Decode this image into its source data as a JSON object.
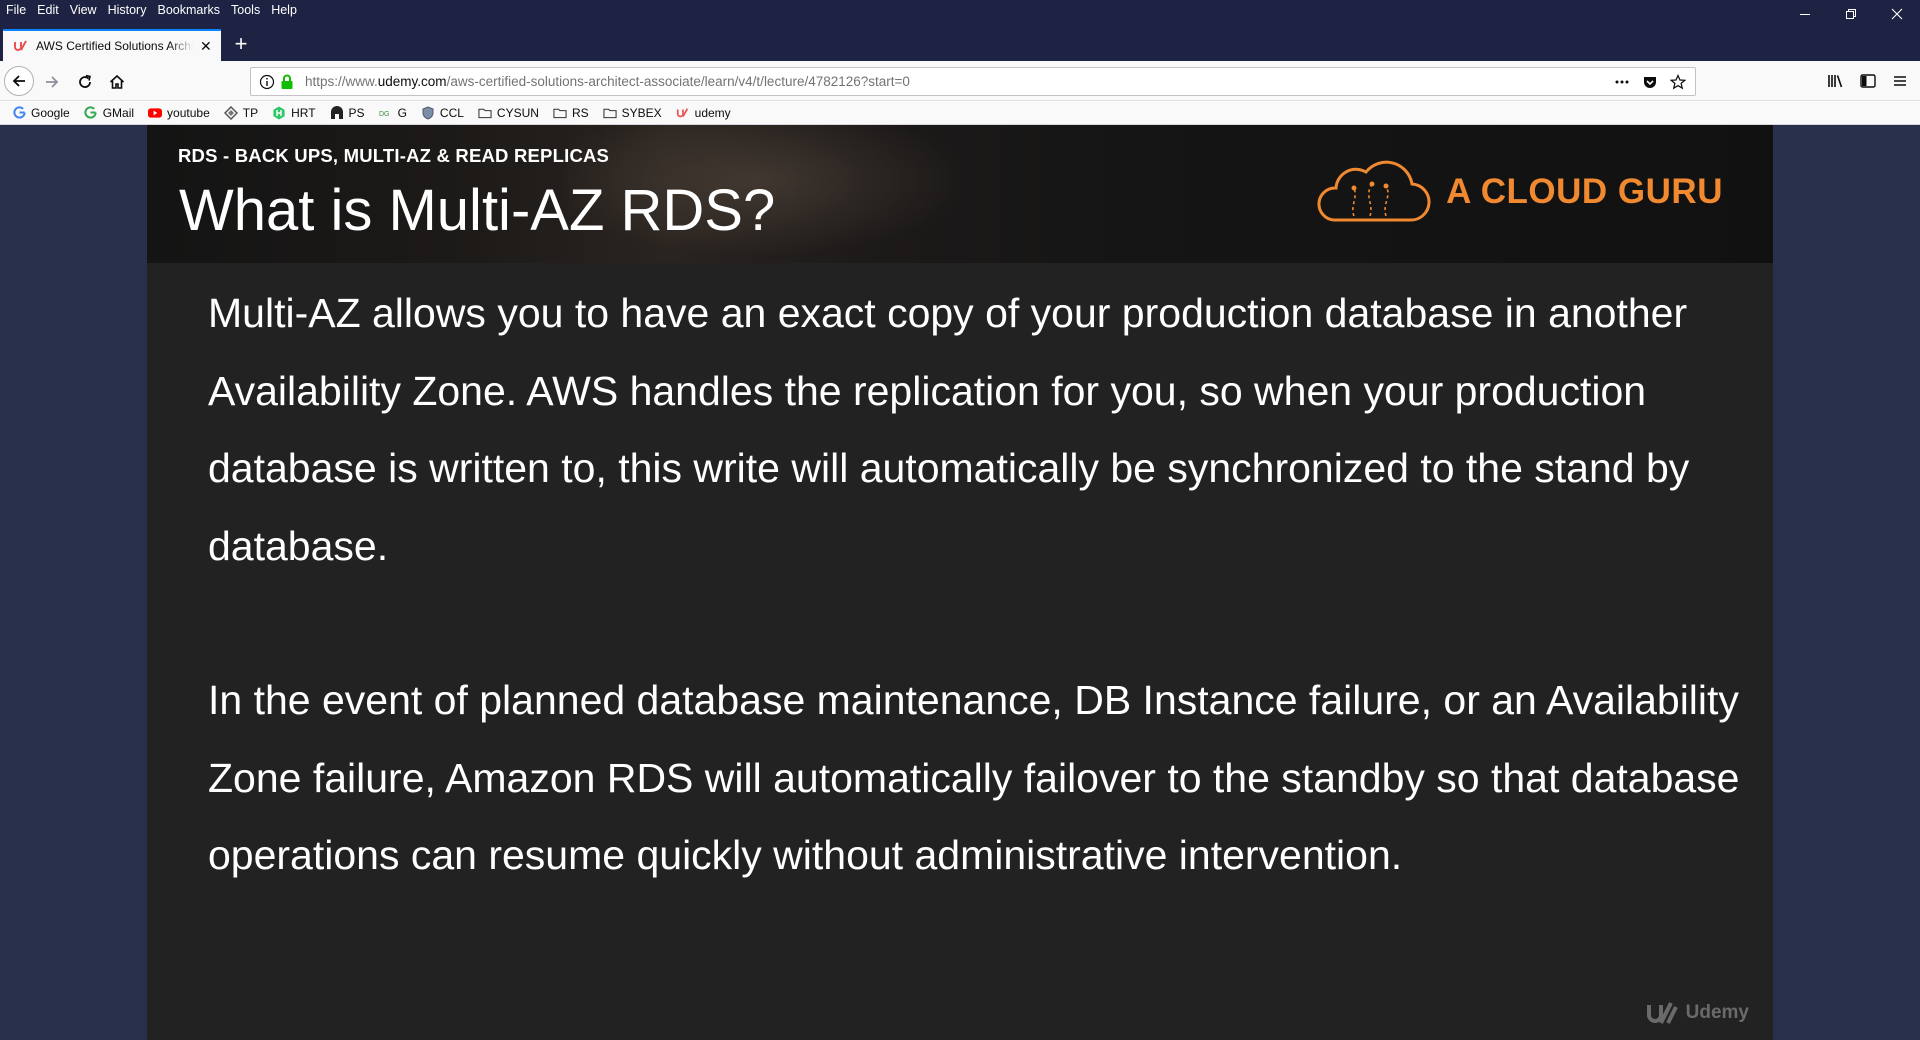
{
  "menubar": {
    "items": [
      "File",
      "Edit",
      "View",
      "History",
      "Bookmarks",
      "Tools",
      "Help"
    ]
  },
  "window_controls": {
    "minimize_icon": "minimize-icon",
    "restore_icon": "restore-icon",
    "close_icon": "close-icon"
  },
  "tab": {
    "title": "AWS Certified Solutions Architect",
    "favicon": "udemy-icon"
  },
  "new_tab": {
    "label": "+"
  },
  "urlbar": {
    "prefix": "https://www.",
    "host": "udemy.com",
    "path": "/aws-certified-solutions-architect-associate/learn/v4/t/lecture/4782126?start=0"
  },
  "bookmarks": [
    {
      "label": "Google",
      "icon": "google-icon"
    },
    {
      "label": "GMail",
      "icon": "google-icon"
    },
    {
      "label": "youtube",
      "icon": "youtube-icon"
    },
    {
      "label": "TP",
      "icon": "tp-icon"
    },
    {
      "label": "HRT",
      "icon": "hackerrank-icon"
    },
    {
      "label": "PS",
      "icon": "ps-icon"
    },
    {
      "label": "G",
      "icon": "g-icon"
    },
    {
      "label": "CCL",
      "icon": "ccl-icon"
    },
    {
      "label": "CYSUN",
      "icon": "folder-icon"
    },
    {
      "label": "RS",
      "icon": "folder-icon"
    },
    {
      "label": "SYBEX",
      "icon": "folder-icon"
    },
    {
      "label": "udemy",
      "icon": "udemy-icon"
    }
  ],
  "slide": {
    "section": "RDS - BACK UPS, MULTI-AZ & READ REPLICAS",
    "title": "What is Multi-AZ RDS?",
    "brand": "A CLOUD GURU",
    "paragraphs": [
      "Multi-AZ allows you to have an exact copy of your production database in another Availability Zone. AWS handles the replication for you, so when your production database is written to, this write will automatically be synchronized to the stand by database.",
      "In the event of planned database maintenance, DB Instance failure, or an Availability Zone failure, Amazon RDS will automatically failover to the standby so that database operations can resume quickly without administrative intervention."
    ],
    "watermark": "Udemy"
  },
  "colors": {
    "brand_orange": "#f0892f",
    "chrome_dark": "#1e2343",
    "page_bg": "#29304b",
    "video_bg": "#222222"
  }
}
